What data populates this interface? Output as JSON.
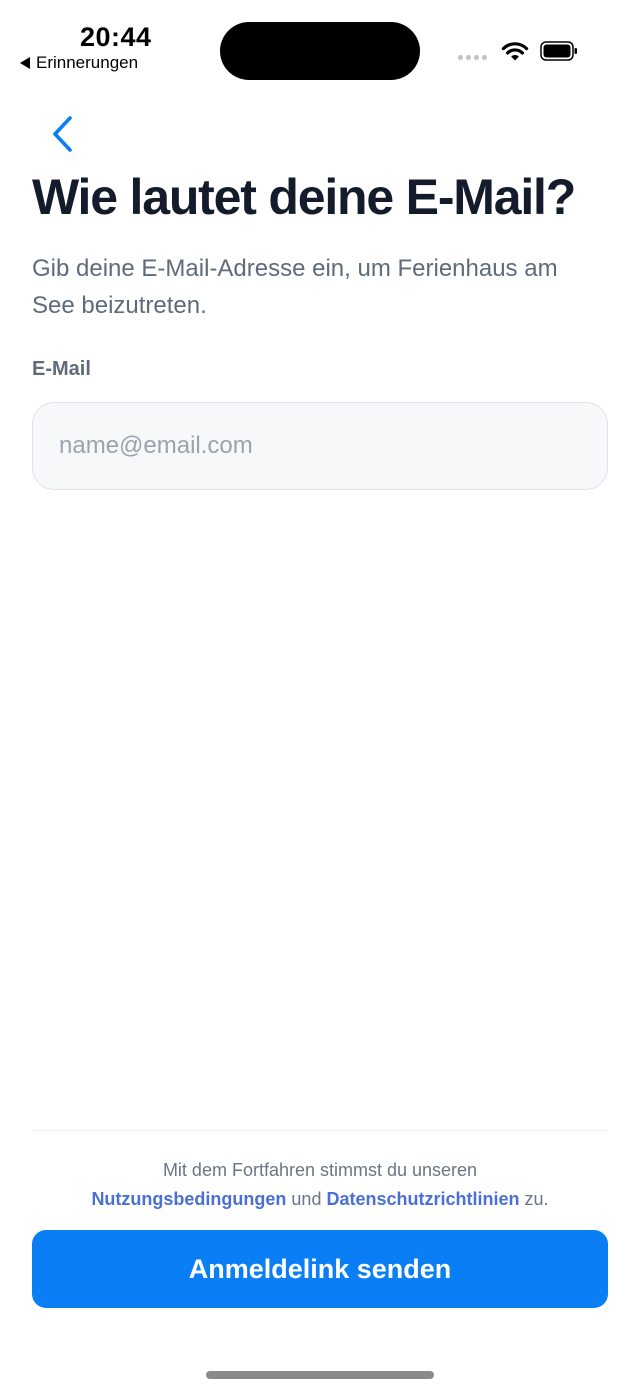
{
  "status_bar": {
    "time": "20:44",
    "back_app": "Erinnerungen"
  },
  "icons": {
    "back": "chevron-left-icon",
    "wifi": "wifi-icon",
    "battery": "battery-icon"
  },
  "colors": {
    "accent": "#0a7ff5",
    "link": "#4a6fd6",
    "title": "#141c2c",
    "muted": "#5f6b7c"
  },
  "page": {
    "title": "Wie lautet deine E-Mail?",
    "subtitle": "Gib deine E-Mail-Adresse ein, um Ferienhaus am See beizutreten."
  },
  "form": {
    "email_label": "E-Mail",
    "email_placeholder": "name@email.com",
    "email_value": ""
  },
  "footer": {
    "terms_prefix": "Mit dem Fortfahren stimmst du unseren",
    "terms_link": "Nutzungsbedingungen",
    "terms_and": "und",
    "privacy_link": "Datenschutzrichtlinien",
    "terms_suffix": "zu.",
    "submit_label": "Anmeldelink senden"
  }
}
